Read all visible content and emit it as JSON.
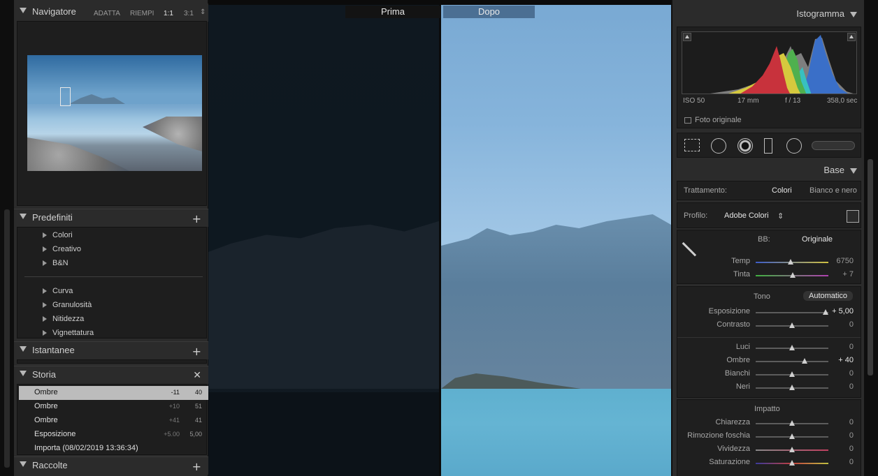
{
  "left_panel": {
    "navigator": {
      "title": "Navigatore",
      "zoom_options": [
        "ADATTA",
        "RIEMPI",
        "1:1",
        "3:1"
      ]
    },
    "presets": {
      "title": "Predefiniti",
      "add_icon": "plus-icon",
      "groups_a": [
        "Colori",
        "Creativo",
        "B&N"
      ],
      "groups_b": [
        "Curva",
        "Granulosità",
        "Nitidezza",
        "Vignettatura"
      ]
    },
    "snapshots": {
      "title": "Istantanee",
      "add_icon": "plus-icon"
    },
    "history": {
      "title": "Storia",
      "clear_icon": "close-icon",
      "items": [
        {
          "name": "Ombre",
          "delta": "-11",
          "value": "40"
        },
        {
          "name": "Ombre",
          "delta": "+10",
          "value": "51"
        },
        {
          "name": "Ombre",
          "delta": "+41",
          "value": "41"
        },
        {
          "name": "Esposizione",
          "delta": "+5.00",
          "value": "5,00"
        },
        {
          "name": "Importa (08/02/2019 13:36:34)",
          "delta": "",
          "value": ""
        }
      ]
    },
    "collections": {
      "title": "Raccolte",
      "add_icon": "plus-icon"
    }
  },
  "view": {
    "before_label": "Prima",
    "after_label": "Dopo"
  },
  "right_panel": {
    "histogram": {
      "title": "Istogramma",
      "iso": "ISO 50",
      "focal": "17 mm",
      "aperture": "f / 13",
      "shutter": "358,0 sec",
      "original_photo": "Foto originale"
    },
    "basic": {
      "title": "Base",
      "treatment_label": "Trattamento:",
      "treatment_color": "Colori",
      "treatment_bw": "Bianco e nero",
      "profile_label": "Profilo:",
      "profile_value": "Adobe Colori",
      "wb_label": "BB:",
      "wb_value": "Originale",
      "temp_label": "Temp",
      "temp_value": "6750",
      "tint_label": "Tinta",
      "tint_value": "+ 7",
      "tone_label": "Tono",
      "auto_label": "Automatico",
      "exposure_label": "Esposizione",
      "exposure_value": "+ 5,00",
      "contrast_label": "Contrasto",
      "contrast_value": "0",
      "highlights_label": "Luci",
      "highlights_value": "0",
      "shadows_label": "Ombre",
      "shadows_value": "+ 40",
      "whites_label": "Bianchi",
      "whites_value": "0",
      "blacks_label": "Neri",
      "blacks_value": "0",
      "presence_label": "Impatto",
      "clarity_label": "Chiarezza",
      "clarity_value": "0",
      "dehaze_label": "Rimozione foschia",
      "dehaze_value": "0",
      "vibrance_label": "Vividezza",
      "vibrance_value": "0",
      "saturation_label": "Saturazione",
      "saturation_value": "0"
    }
  }
}
